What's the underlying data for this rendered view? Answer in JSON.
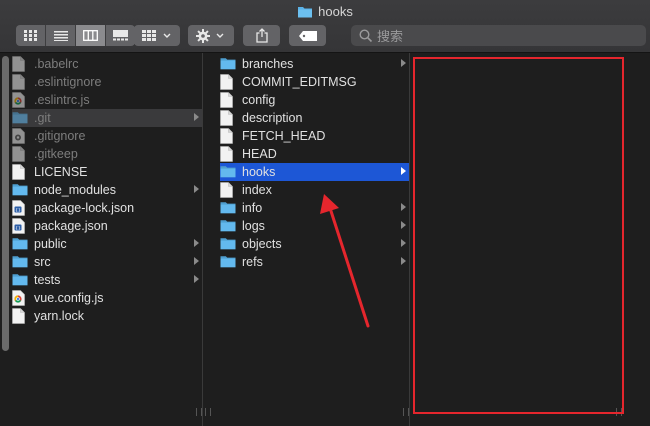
{
  "window": {
    "title": "hooks"
  },
  "toolbar": {
    "view_buttons": [
      "icon-view",
      "list-view",
      "column-view",
      "gallery-view"
    ],
    "active_view": "column-view",
    "group_button": "grid-group-icon",
    "action_button": "gear-icon",
    "share_button": "share-icon",
    "tag_button": "tag-icon",
    "search_placeholder": "搜索"
  },
  "column1": {
    "items": [
      {
        "label": ".babelrc",
        "icon": "file-icon",
        "dim": true
      },
      {
        "label": ".eslintignore",
        "icon": "file-icon",
        "dim": true
      },
      {
        "label": ".eslintrc.js",
        "icon": "chrome-file-icon",
        "dim": true
      },
      {
        "label": ".git",
        "icon": "folder-icon",
        "dim": true,
        "selected": true,
        "has_children": true
      },
      {
        "label": ".gitignore",
        "icon": "gear-file-icon",
        "dim": true
      },
      {
        "label": ".gitkeep",
        "icon": "file-icon",
        "dim": true
      },
      {
        "label": "LICENSE",
        "icon": "file-icon",
        "dim": false
      },
      {
        "label": "node_modules",
        "icon": "folder-icon",
        "dim": false,
        "has_children": true
      },
      {
        "label": "package-lock.json",
        "icon": "json-file-icon",
        "dim": false
      },
      {
        "label": "package.json",
        "icon": "json-file-icon",
        "dim": false
      },
      {
        "label": "public",
        "icon": "folder-icon",
        "dim": false,
        "has_children": true
      },
      {
        "label": "src",
        "icon": "folder-icon",
        "dim": false,
        "has_children": true
      },
      {
        "label": "tests",
        "icon": "folder-icon",
        "dim": false,
        "has_children": true
      },
      {
        "label": "vue.config.js",
        "icon": "chrome-file-icon",
        "dim": false
      },
      {
        "label": "yarn.lock",
        "icon": "file-icon",
        "dim": false
      }
    ]
  },
  "column2": {
    "items": [
      {
        "label": "branches",
        "icon": "folder-icon",
        "has_children": true
      },
      {
        "label": "COMMIT_EDITMSG",
        "icon": "file-icon"
      },
      {
        "label": "config",
        "icon": "file-icon"
      },
      {
        "label": "description",
        "icon": "file-icon"
      },
      {
        "label": "FETCH_HEAD",
        "icon": "file-icon"
      },
      {
        "label": "HEAD",
        "icon": "file-icon"
      },
      {
        "label": "hooks",
        "icon": "folder-icon",
        "has_children": true,
        "selected": true
      },
      {
        "label": "index",
        "icon": "file-icon"
      },
      {
        "label": "info",
        "icon": "folder-icon",
        "has_children": true
      },
      {
        "label": "logs",
        "icon": "folder-icon",
        "has_children": true
      },
      {
        "label": "objects",
        "icon": "folder-icon",
        "has_children": true
      },
      {
        "label": "refs",
        "icon": "folder-icon",
        "has_children": true
      }
    ]
  },
  "colors": {
    "selection_blue": "#1d57d6",
    "annotation_red": "#e5262d",
    "folder_blue": "#5ab1e6"
  }
}
